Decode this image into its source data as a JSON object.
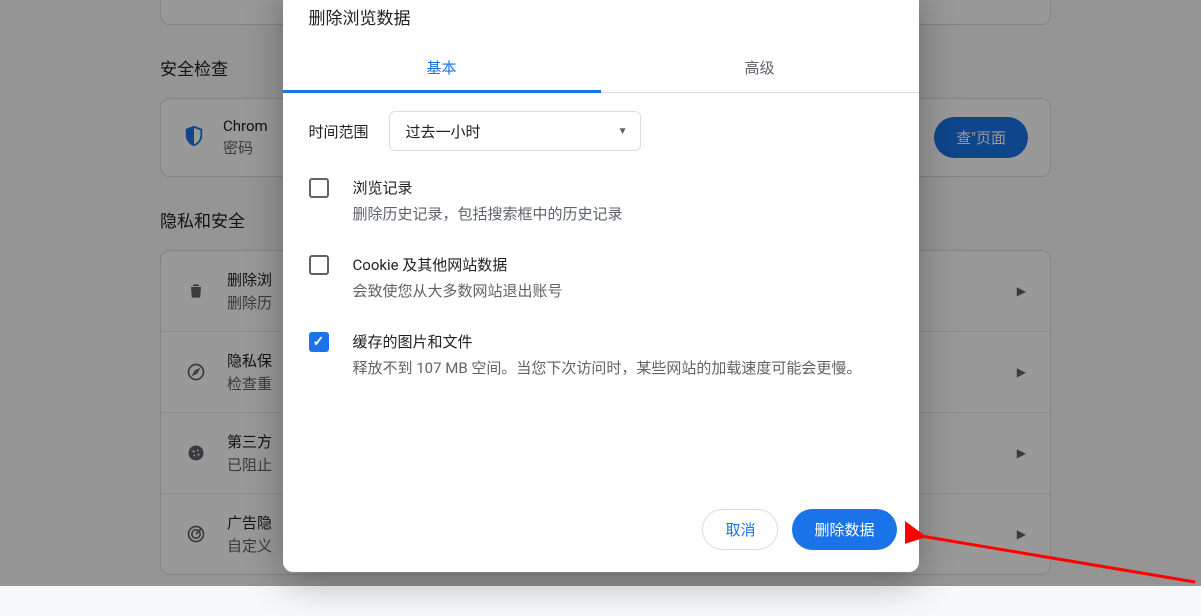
{
  "background": {
    "sections": {
      "safety_title": "安全检查",
      "safety_card": {
        "line1": "Chrom",
        "line2": "密码",
        "button": "查\"页面"
      },
      "privacy_title": "隐私和安全",
      "rows": [
        {
          "icon": "trash",
          "line1": "删除浏",
          "line2": "删除历"
        },
        {
          "icon": "compass",
          "line1": "隐私保",
          "line2": "检查重"
        },
        {
          "icon": "cookie",
          "line1": "第三方",
          "line2": "已阻止"
        },
        {
          "icon": "target",
          "line1": "广告隐",
          "line2": "自定义"
        }
      ]
    }
  },
  "dialog": {
    "title": "删除浏览数据",
    "tabs": {
      "basic": "基本",
      "advanced": "高级"
    },
    "time": {
      "label": "时间范围",
      "value": "过去一小时"
    },
    "options": [
      {
        "checked": false,
        "title": "浏览记录",
        "desc": "删除历史记录，包括搜索框中的历史记录"
      },
      {
        "checked": false,
        "title": "Cookie 及其他网站数据",
        "desc": "会致使您从大多数网站退出账号"
      },
      {
        "checked": true,
        "title": "缓存的图片和文件",
        "desc": "释放不到 107 MB 空间。当您下次访问时，某些网站的加载速度可能会更慢。"
      }
    ],
    "buttons": {
      "cancel": "取消",
      "confirm": "删除数据"
    }
  }
}
